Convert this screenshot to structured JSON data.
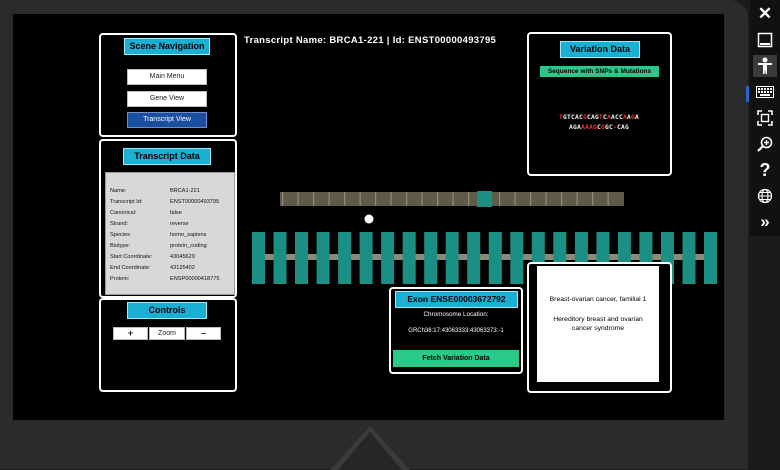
{
  "title": {
    "transcript_label": "Transcript Name:",
    "transcript_name": "BRCA1-221",
    "separator": "|",
    "id_label": "Id:",
    "id_value": "ENST00000493795"
  },
  "scene_nav": {
    "header": "Scene Navigation",
    "buttons": [
      "Main Menu",
      "Gene View",
      "Transcript View"
    ]
  },
  "transcript_data": {
    "header": "Transcript Data",
    "rows": [
      {
        "key": "Name:",
        "value": "BRCA1-221"
      },
      {
        "key": "Transcript Id:",
        "value": "ENST00000493795"
      },
      {
        "key": "Canonical:",
        "value": "false"
      },
      {
        "key": "Strand:",
        "value": "reverse"
      },
      {
        "key": "Species",
        "value": "homo_sapiens"
      },
      {
        "key": "Biotype:",
        "value": "protein_coding"
      },
      {
        "key": "Start Coordinate:",
        "value": "43045629"
      },
      {
        "key": "End Coordinate:",
        "value": "43125402"
      },
      {
        "key": "Protein:",
        "value": "ENSP00000418775"
      }
    ]
  },
  "controls": {
    "header": "Controls",
    "plus": "+",
    "zoom": "Zoom",
    "minus": "–"
  },
  "variation": {
    "header": "Variation Data",
    "subheader": "Sequence with SNPs & Mutations",
    "seq_line1": [
      {
        "t": "T",
        "c": "#ff3030"
      },
      {
        "t": "GTCAC",
        "c": "#ffffff"
      },
      {
        "t": "G",
        "c": "#ff3030"
      },
      {
        "t": "CAG",
        "c": "#ffffff"
      },
      {
        "t": "T",
        "c": "#ff3030"
      },
      {
        "t": "C",
        "c": "#ffffff"
      },
      {
        "t": "A",
        "c": "#ff3030"
      },
      {
        "t": "ACC",
        "c": "#ffffff"
      },
      {
        "t": "A",
        "c": "#ff3030"
      },
      {
        "t": "A",
        "c": "#ffffff"
      },
      {
        "t": "G",
        "c": "#ff3030"
      },
      {
        "t": "A",
        "c": "#ffffff"
      }
    ],
    "seq_line2": [
      {
        "t": "AGA",
        "c": "#ffffff"
      },
      {
        "t": "AAAG",
        "c": "#ff3030"
      },
      {
        "t": "C",
        "c": "#ffffff"
      },
      {
        "t": "G",
        "c": "#ff3030"
      },
      {
        "t": "GC",
        "c": "#ffffff"
      },
      {
        "t": "-",
        "c": "#ff3030"
      },
      {
        "t": "CAG",
        "c": "#ffffff"
      }
    ]
  },
  "exon": {
    "header": "Exon ENSE00003672792",
    "location_label": "Chromosome Location:",
    "location_value": "GRCh38:17:43063333:43063373:-1",
    "fetch_button": "Fetch Variation Data"
  },
  "disease": {
    "line1": "Breast-ovarian cancer, familial 1",
    "line2": "Hereditory breast and ovarian cancer syndrome"
  },
  "colors": {
    "accent": "#1ab0d4",
    "exon": "#1c8f84",
    "button_active": "#1a4fa0",
    "fetch": "#29c98a"
  },
  "exon_count": 22,
  "sidebar": [
    "close-icon",
    "minimize-icon",
    "person-icon",
    "keyboard-icon",
    "fit-screen-icon",
    "zoom-in-icon",
    "help-icon",
    "globe-icon",
    "chevron-double-right-icon"
  ]
}
